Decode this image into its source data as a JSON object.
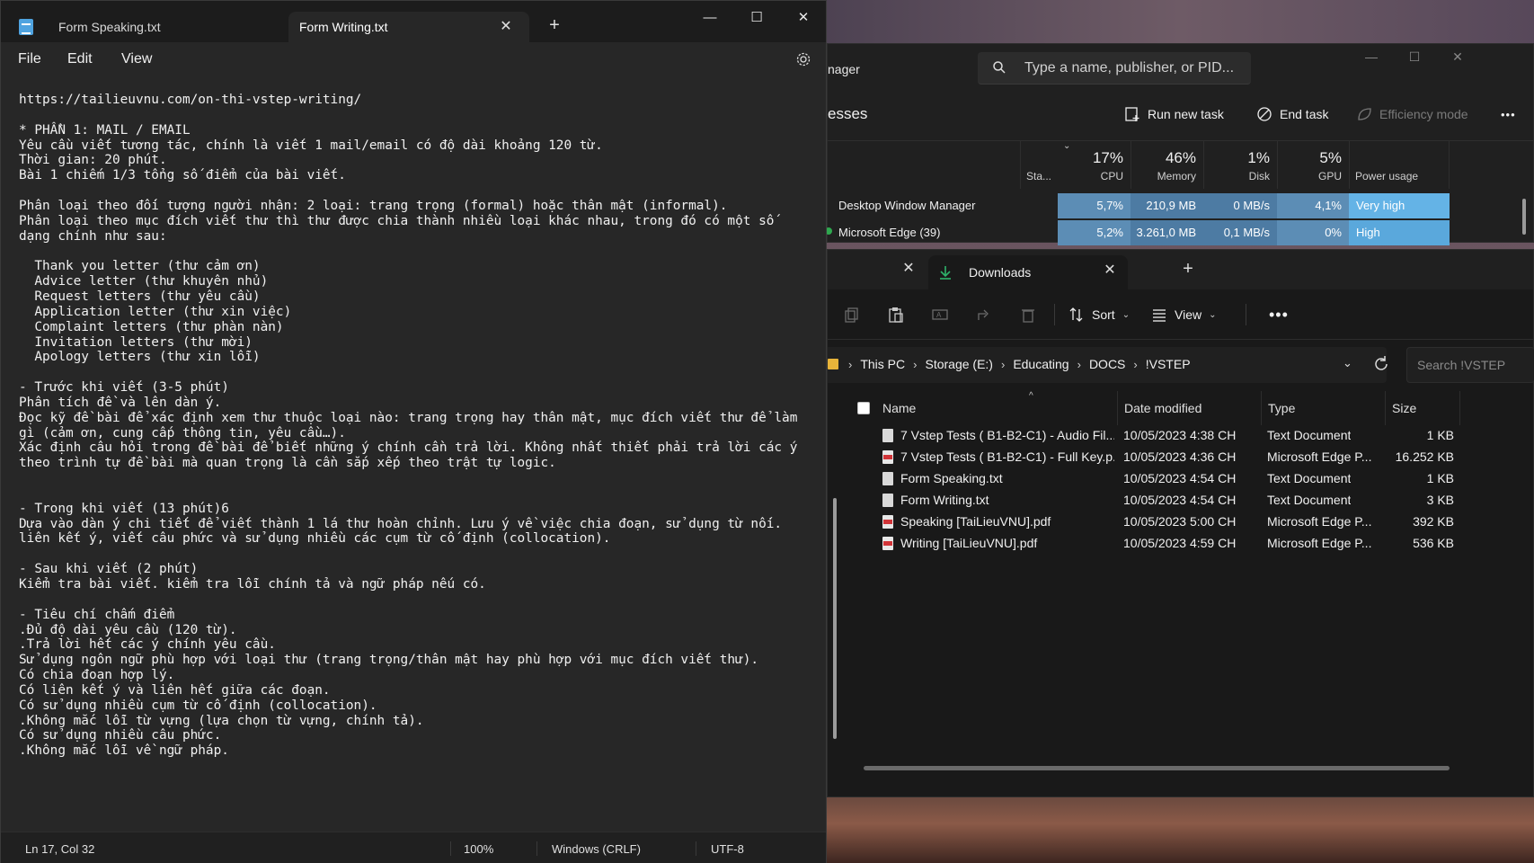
{
  "notepad": {
    "tabs": [
      {
        "label": "Form Speaking.txt",
        "active": false
      },
      {
        "label": "Form Writing.txt",
        "active": true
      }
    ],
    "new_tab": "+",
    "window_buttons": {
      "minimize": "—",
      "maximize": "☐",
      "close": "✕"
    },
    "tab_close": "✕",
    "menu": {
      "file": "File",
      "edit": "Edit",
      "view": "View"
    },
    "content_lines": [
      "https://tailieuvnu.com/on-thi-vstep-writing/",
      "",
      "* PHẦN 1: MAIL / EMAIL",
      "Yêu cầu viết tương tác, chính là viết 1 mail/email có độ dài khoảng 120 từ.",
      "Thời gian: 20 phút.",
      "Bài 1 chiếm 1/3 tổng số điểm của bài viết.",
      "",
      "Phân loại theo đối tượng người nhận: 2 loại: trang trọng (formal) hoặc thân mật (informal).",
      "Phân loại theo mục đích viết thư thì thư được chia thành nhiều loại khác nhau, trong đó có một số",
      "dạng chính như sau:",
      "",
      "  Thank you letter (thư cảm ơn)",
      "  Advice letter (thư khuyên nhủ)",
      "  Request letters (thư yêu cầu)",
      "  Application letter (thư xin việc)",
      "  Complaint letters (thư phàn nàn)",
      "  Invitation letters (thư mời)",
      "  Apology letters (thư xin lỗi)",
      "",
      "- Trước khi viết (3-5 phút)",
      "Phân tích đề và lên dàn ý.",
      "Đọc kỹ đề bài để xác định xem thư thuộc loại nào: trang trọng hay thân mật, mục đích viết thư để làm",
      "gì (cảm ơn, cung cấp thông tin, yêu cầu…).",
      "Xác định câu hỏi trong đề bài để biết những ý chính cần trả lời. Không nhất thiết phải trả lời các ý",
      "theo trình tự đề bài mà quan trọng là cần sắp xếp theo trật tự logic.",
      "",
      "",
      "- Trong khi viết (13 phút)6",
      "Dựa vào dàn ý chi tiết để viết thành 1 lá thư hoàn chỉnh. Lưu ý về việc chia đoạn, sử dụng từ nối.",
      "liên kết ý, viết câu phức và sử dụng nhiều các cụm từ cố định (collocation).",
      "",
      "- Sau khi viết (2 phút)",
      "Kiểm tra bài viết. kiểm tra lỗi chính tả và ngữ pháp nếu có.",
      "",
      "- Tiêu chí chấm điểm",
      ".Đủ độ dài yêu cầu (120 từ).",
      ".Trả lời hết các ý chính yêu cầu.",
      "Sử dụng ngôn ngữ phù hợp với loại thư (trang trọng/thân mật hay phù hợp với mục đích viết thư).",
      "Có chia đoạn hợp lý.",
      "Có liên kết ý và liên hết giữa các đoạn.",
      "Có sử dụng nhiều cụm từ cố định (collocation).",
      ".Không mắc lỗi từ vựng (lựa chọn từ vựng, chính tả).",
      "Có sử dụng nhiều câu phức.",
      ".Không mắc lỗi về ngữ pháp."
    ],
    "status": {
      "position": "Ln 17, Col 32",
      "zoom": "100%",
      "line_ending": "Windows (CRLF)",
      "encoding": "UTF-8"
    }
  },
  "task_manager": {
    "title": "nager",
    "search_placeholder": "Type a name, publisher, or PID...",
    "window_buttons": {
      "minimize": "—",
      "maximize": "☐",
      "close": "✕"
    },
    "section_title": "esses",
    "actions": {
      "run_new_task": "Run new task",
      "end_task": "End task",
      "efficiency_mode": "Efficiency mode",
      "more": "•••"
    },
    "columns": {
      "status": "Sta...",
      "cpu": {
        "pct": "17%",
        "label": "CPU"
      },
      "memory": {
        "pct": "46%",
        "label": "Memory"
      },
      "disk": {
        "pct": "1%",
        "label": "Disk"
      },
      "gpu": {
        "pct": "5%",
        "label": "GPU"
      },
      "power": "Power usage"
    },
    "processes": [
      {
        "name": "Desktop Window Manager",
        "cpu": "5,7%",
        "memory": "210,9 MB",
        "disk": "0 MB/s",
        "gpu": "4,1%",
        "power": "Very high"
      },
      {
        "name": "Microsoft Edge (39)",
        "cpu": "5,2%",
        "memory": "3.261,0 MB",
        "disk": "0,1 MB/s",
        "gpu": "0%",
        "power": "High"
      }
    ],
    "colors": {
      "cpu_cell": "#5c8db5",
      "mem_cell": "#4d7ba3",
      "disk_cell": "#4d7ba3",
      "gpu_cell": "#5c8db5",
      "power_very_high": "#64b3e6",
      "power_high": "#5aa8dc"
    }
  },
  "explorer": {
    "tab": {
      "label": "Downloads",
      "close": "✕"
    },
    "prev_tab_close": "✕",
    "new_tab": "+",
    "toolbar": {
      "sort": "Sort",
      "view": "View",
      "more": "•••"
    },
    "breadcrumb": [
      "This PC",
      "Storage (E:)",
      "Educating",
      "DOCS",
      "!VSTEP"
    ],
    "search_placeholder": "Search !VSTEP",
    "columns": {
      "name": "Name",
      "date": "Date modified",
      "type": "Type",
      "size": "Size"
    },
    "files": [
      {
        "name": "7 Vstep Tests ( B1-B2-C1) - Audio Fil...",
        "date": "10/05/2023 4:38 CH",
        "type": "Text Document",
        "size": "1 KB",
        "icon": "txt"
      },
      {
        "name": "7 Vstep Tests ( B1-B2-C1) - Full Key.p...",
        "date": "10/05/2023 4:36 CH",
        "type": "Microsoft Edge P...",
        "size": "16.252 KB",
        "icon": "pdf"
      },
      {
        "name": "Form Speaking.txt",
        "date": "10/05/2023 4:54 CH",
        "type": "Text Document",
        "size": "1 KB",
        "icon": "txt"
      },
      {
        "name": "Form Writing.txt",
        "date": "10/05/2023 4:54 CH",
        "type": "Text Document",
        "size": "3 KB",
        "icon": "txt"
      },
      {
        "name": "Speaking [TaiLieuVNU].pdf",
        "date": "10/05/2023 5:00 CH",
        "type": "Microsoft Edge P...",
        "size": "392 KB",
        "icon": "pdf"
      },
      {
        "name": "Writing [TaiLieuVNU].pdf",
        "date": "10/05/2023 4:59 CH",
        "type": "Microsoft Edge P...",
        "size": "536 KB",
        "icon": "pdf"
      }
    ]
  }
}
